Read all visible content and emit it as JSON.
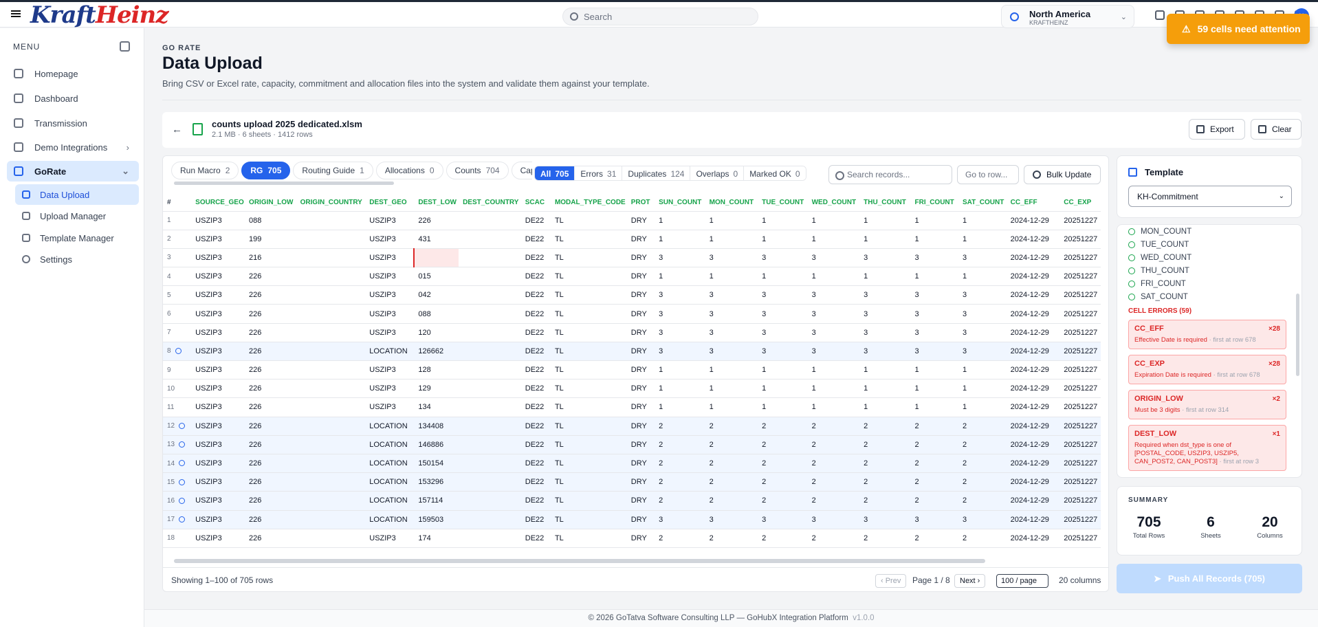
{
  "brand": {
    "logo_part1": "Kraft",
    "logo_part2": "Heinz"
  },
  "topbar": {
    "search_placeholder": "Search",
    "region_name": "North America",
    "region_org": "KRAFTHEINZ",
    "avatar": "U"
  },
  "toast": {
    "text": "59 cells need attention",
    "icon": "warning-icon"
  },
  "sidebar": {
    "menu_label": "MENU",
    "items": [
      {
        "label": "Homepage",
        "icon": "home-icon"
      },
      {
        "label": "Dashboard",
        "icon": "chart-icon"
      },
      {
        "label": "Transmission",
        "icon": "server-icon"
      },
      {
        "label": "Demo Integrations",
        "icon": "building-icon"
      },
      {
        "label": "GoRate",
        "icon": "dollar-icon"
      }
    ],
    "subitems": [
      {
        "label": "Data Upload",
        "icon": "upload-icon"
      },
      {
        "label": "Upload Manager",
        "icon": "inbox-icon"
      },
      {
        "label": "Template Manager",
        "icon": "table-icon"
      },
      {
        "label": "Settings",
        "icon": "gear-icon"
      }
    ]
  },
  "page": {
    "crumb": "GO RATE",
    "title": "Data Upload",
    "description": "Bring CSV or Excel rate, capacity, commitment and allocation files into the system and validate them against your template."
  },
  "file": {
    "name": "counts upload 2025 dedicated.xlsm",
    "meta": "2.1 MB · 6 sheets · 1412 rows",
    "export_label": "Export",
    "clear_label": "Clear"
  },
  "sheets": [
    {
      "label": "Run Macro",
      "count": "2"
    },
    {
      "label": "RG",
      "count": "705",
      "active": true
    },
    {
      "label": "Routing Guide",
      "count": "1"
    },
    {
      "label": "Allocations",
      "count": "0"
    },
    {
      "label": "Counts",
      "count": "704"
    },
    {
      "label": "Capa",
      "count": ""
    }
  ],
  "filters": [
    {
      "label": "All",
      "count": "705",
      "active": true
    },
    {
      "label": "Errors",
      "count": "31"
    },
    {
      "label": "Duplicates",
      "count": "124"
    },
    {
      "label": "Overlaps",
      "count": "0"
    },
    {
      "label": "Marked OK",
      "count": "0"
    }
  ],
  "toolbar": {
    "search_placeholder": "Search records...",
    "goto_placeholder": "Go to row...",
    "bulk_label": "Bulk Update"
  },
  "table": {
    "columns": [
      "#",
      "SOURCE_GEO",
      "ORIGIN_LOW",
      "ORIGIN_COUNTRY",
      "DEST_GEO",
      "DEST_LOW",
      "DEST_COUNTRY",
      "SCAC",
      "MODAL_TYPE_CODE",
      "PROT",
      "SUN_COUNT",
      "MON_COUNT",
      "TUE_COUNT",
      "WED_COUNT",
      "THU_COUNT",
      "FRI_COUNT",
      "SAT_COUNT",
      "CC_EFF",
      "CC_EXP"
    ],
    "rows": [
      [
        "1",
        "USZIP3",
        "088",
        "",
        "USZIP3",
        "226",
        "",
        "DE22",
        "TL",
        "DRY",
        "1",
        "1",
        "1",
        "1",
        "1",
        "1",
        "1",
        "2024-12-29",
        "20251227"
      ],
      [
        "2",
        "USZIP3",
        "199",
        "",
        "USZIP3",
        "431",
        "",
        "DE22",
        "TL",
        "DRY",
        "1",
        "1",
        "1",
        "1",
        "1",
        "1",
        "1",
        "2024-12-29",
        "20251227"
      ],
      [
        "3",
        "USZIP3",
        "216",
        "",
        "USZIP3",
        "",
        "",
        "DE22",
        "TL",
        "DRY",
        "3",
        "3",
        "3",
        "3",
        "3",
        "3",
        "3",
        "2024-12-29",
        "20251227"
      ],
      [
        "4",
        "USZIP3",
        "226",
        "",
        "USZIP3",
        "015",
        "",
        "DE22",
        "TL",
        "DRY",
        "1",
        "1",
        "1",
        "1",
        "1",
        "1",
        "1",
        "2024-12-29",
        "20251227"
      ],
      [
        "5",
        "USZIP3",
        "226",
        "",
        "USZIP3",
        "042",
        "",
        "DE22",
        "TL",
        "DRY",
        "3",
        "3",
        "3",
        "3",
        "3",
        "3",
        "3",
        "2024-12-29",
        "20251227"
      ],
      [
        "6",
        "USZIP3",
        "226",
        "",
        "USZIP3",
        "088",
        "",
        "DE22",
        "TL",
        "DRY",
        "3",
        "3",
        "3",
        "3",
        "3",
        "3",
        "3",
        "2024-12-29",
        "20251227"
      ],
      [
        "7",
        "USZIP3",
        "226",
        "",
        "USZIP3",
        "120",
        "",
        "DE22",
        "TL",
        "DRY",
        "3",
        "3",
        "3",
        "3",
        "3",
        "3",
        "3",
        "2024-12-29",
        "20251227"
      ],
      [
        "8",
        "USZIP3",
        "226",
        "",
        "LOCATION",
        "126662",
        "",
        "DE22",
        "TL",
        "DRY",
        "3",
        "3",
        "3",
        "3",
        "3",
        "3",
        "3",
        "2024-12-29",
        "20251227"
      ],
      [
        "9",
        "USZIP3",
        "226",
        "",
        "USZIP3",
        "128",
        "",
        "DE22",
        "TL",
        "DRY",
        "1",
        "1",
        "1",
        "1",
        "1",
        "1",
        "1",
        "2024-12-29",
        "20251227"
      ],
      [
        "10",
        "USZIP3",
        "226",
        "",
        "USZIP3",
        "129",
        "",
        "DE22",
        "TL",
        "DRY",
        "1",
        "1",
        "1",
        "1",
        "1",
        "1",
        "1",
        "2024-12-29",
        "20251227"
      ],
      [
        "11",
        "USZIP3",
        "226",
        "",
        "USZIP3",
        "134",
        "",
        "DE22",
        "TL",
        "DRY",
        "1",
        "1",
        "1",
        "1",
        "1",
        "1",
        "1",
        "2024-12-29",
        "20251227"
      ],
      [
        "12",
        "USZIP3",
        "226",
        "",
        "LOCATION",
        "134408",
        "",
        "DE22",
        "TL",
        "DRY",
        "2",
        "2",
        "2",
        "2",
        "2",
        "2",
        "2",
        "2024-12-29",
        "20251227"
      ],
      [
        "13",
        "USZIP3",
        "226",
        "",
        "LOCATION",
        "146886",
        "",
        "DE22",
        "TL",
        "DRY",
        "2",
        "2",
        "2",
        "2",
        "2",
        "2",
        "2",
        "2024-12-29",
        "20251227"
      ],
      [
        "14",
        "USZIP3",
        "226",
        "",
        "LOCATION",
        "150154",
        "",
        "DE22",
        "TL",
        "DRY",
        "2",
        "2",
        "2",
        "2",
        "2",
        "2",
        "2",
        "2024-12-29",
        "20251227"
      ],
      [
        "15",
        "USZIP3",
        "226",
        "",
        "LOCATION",
        "153296",
        "",
        "DE22",
        "TL",
        "DRY",
        "2",
        "2",
        "2",
        "2",
        "2",
        "2",
        "2",
        "2024-12-29",
        "20251227"
      ],
      [
        "16",
        "USZIP3",
        "226",
        "",
        "LOCATION",
        "157114",
        "",
        "DE22",
        "TL",
        "DRY",
        "2",
        "2",
        "2",
        "2",
        "2",
        "2",
        "2",
        "2024-12-29",
        "20251227"
      ],
      [
        "17",
        "USZIP3",
        "226",
        "",
        "LOCATION",
        "159503",
        "",
        "DE22",
        "TL",
        "DRY",
        "3",
        "3",
        "3",
        "3",
        "3",
        "3",
        "3",
        "2024-12-29",
        "20251227"
      ],
      [
        "18",
        "USZIP3",
        "226",
        "",
        "USZIP3",
        "174",
        "",
        "DE22",
        "TL",
        "DRY",
        "2",
        "2",
        "2",
        "2",
        "2",
        "2",
        "2",
        "2024-12-29",
        "20251227"
      ]
    ],
    "marked_rows": [
      "8",
      "12",
      "13",
      "14",
      "15",
      "16",
      "17"
    ],
    "error_cell": {
      "row": "3",
      "column": "DEST_LOW"
    }
  },
  "pagination": {
    "showing": "Showing 1–100 of 705 rows",
    "prev": "‹ Prev",
    "page": "Page 1 / 8",
    "next": "Next ›",
    "per_page": "100 / page",
    "columns": "20 columns"
  },
  "template": {
    "title": "Template",
    "selected": "KH-Commitment",
    "columns_ok": [
      "MON_COUNT",
      "TUE_COUNT",
      "WED_COUNT",
      "THU_COUNT",
      "FRI_COUNT",
      "SAT_COUNT"
    ],
    "cell_errors_title": "CELL ERRORS (59)",
    "errors": [
      {
        "name": "CC_EFF",
        "count": "×28",
        "msg": "Effective Date is required",
        "where": " · first at row 678"
      },
      {
        "name": "CC_EXP",
        "count": "×28",
        "msg": "Expiration Date is required",
        "where": " · first at row 678"
      },
      {
        "name": "ORIGIN_LOW",
        "count": "×2",
        "msg": "Must be 3 digits",
        "where": " · first at row 314"
      },
      {
        "name": "DEST_LOW",
        "count": "×1",
        "msg": "Required when dst_type is one of [POSTAL_CODE, USZIP3, USZIP5, CAN_POST2, CAN_POST3]",
        "where": " · first at row 3"
      }
    ]
  },
  "summary": {
    "title": "SUMMARY",
    "total_rows": "705",
    "total_rows_label": "Total Rows",
    "sheets": "6",
    "sheets_label": "Sheets",
    "columns": "20",
    "columns_label": "Columns"
  },
  "push_label": "Push All Records (705)",
  "footer": {
    "text": "© 2026 GoTatva Software Consulting LLP — GoHubX Integration Platform",
    "version": "v1.0.0"
  }
}
